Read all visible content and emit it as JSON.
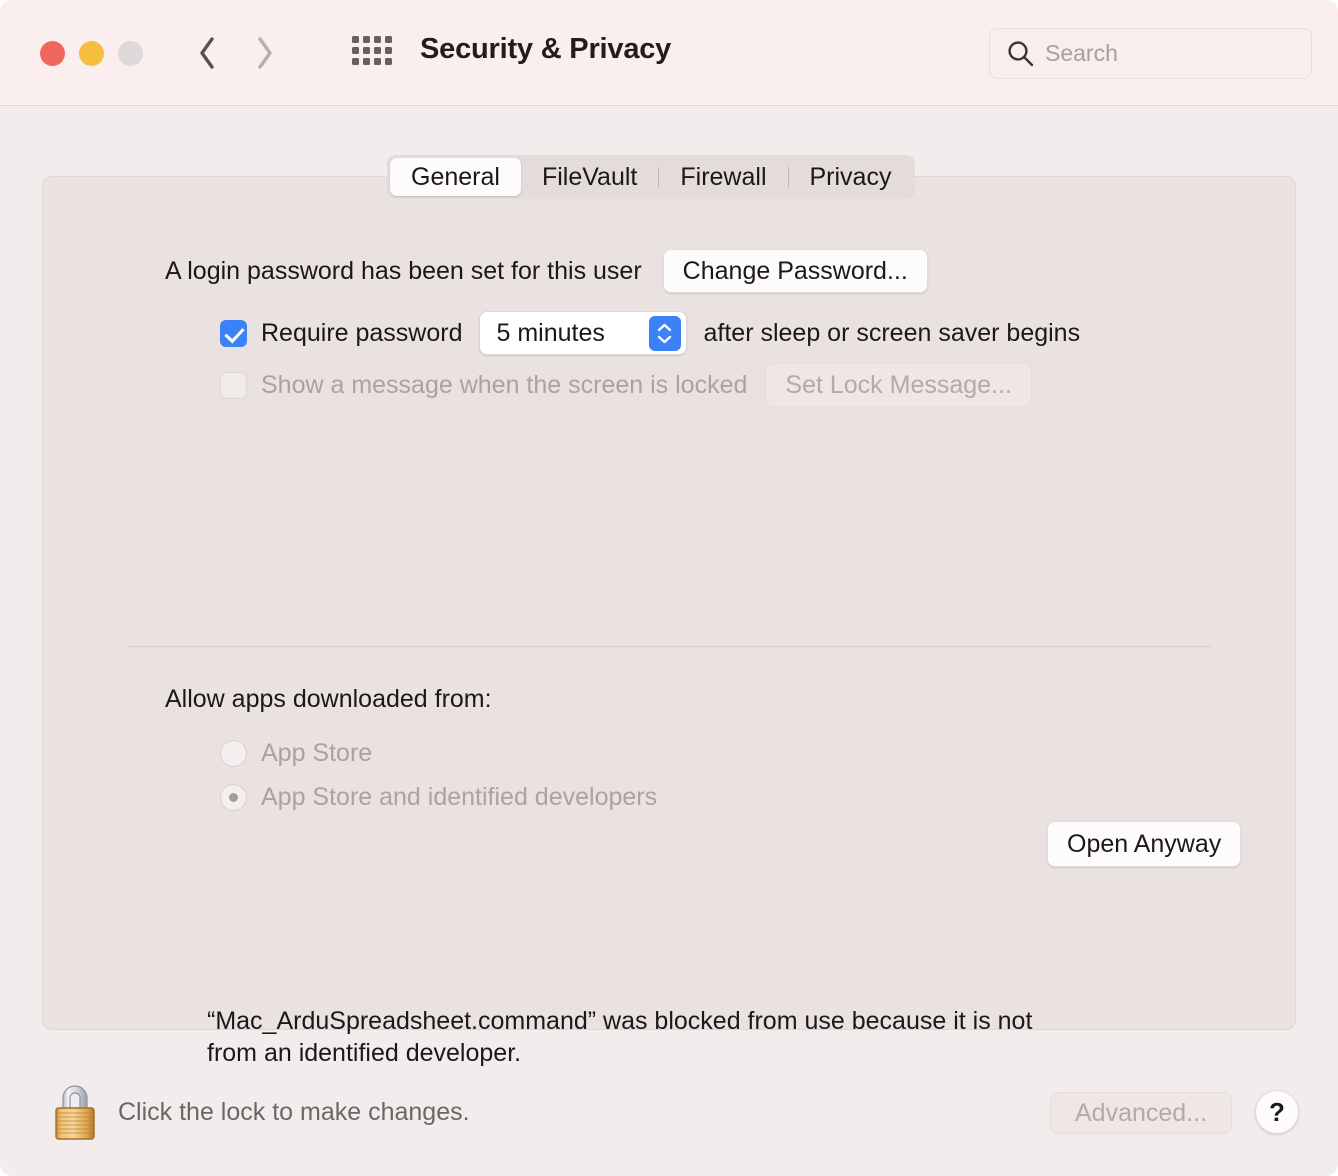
{
  "window": {
    "title": "Security & Privacy",
    "traffic_lights": [
      "close",
      "minimize",
      "zoom"
    ],
    "back_icon": "chevron-left-icon",
    "forward_icon": "chevron-right-icon",
    "grid_icon": "grid-apps-icon"
  },
  "search": {
    "placeholder": "Search",
    "value": "",
    "icon": "search-icon"
  },
  "tabs": [
    {
      "label": "General",
      "active": true
    },
    {
      "label": "FileVault",
      "active": false
    },
    {
      "label": "Firewall",
      "active": false
    },
    {
      "label": "Privacy",
      "active": false
    }
  ],
  "general": {
    "login_password_text": "A login password has been set for this user",
    "change_password_button": "Change Password...",
    "require_password": {
      "checked": true,
      "label": "Require password",
      "interval_value": "5 minutes",
      "suffix": "after sleep or screen saver begins"
    },
    "lock_message": {
      "checked": false,
      "label": "Show a message when the screen is locked",
      "button": "Set Lock Message...",
      "disabled": true
    },
    "allow_apps": {
      "heading": "Allow apps downloaded from:",
      "options": [
        {
          "label": "App Store",
          "selected": false
        },
        {
          "label": "App Store and identified developers",
          "selected": true
        }
      ],
      "disabled": true
    },
    "blocked_message": "“Mac_ArduSpreadsheet.command” was blocked from use because it is not from an identified developer.",
    "open_anyway_button": "Open Anyway"
  },
  "footer": {
    "lock_icon": "padlock-closed-icon",
    "lock_text": "Click the lock to make changes.",
    "advanced_button": "Advanced...",
    "advanced_disabled": true,
    "help_button": "?"
  },
  "colors": {
    "accent_blue": "#3b82f6",
    "window_bg": "#f2edec",
    "toolbar_bg": "#faeeee",
    "panel_bg": "#e9e2e1",
    "close_red": "#f0675c",
    "min_yellow": "#f7bd41",
    "zoom_grey": "#dfdada"
  }
}
